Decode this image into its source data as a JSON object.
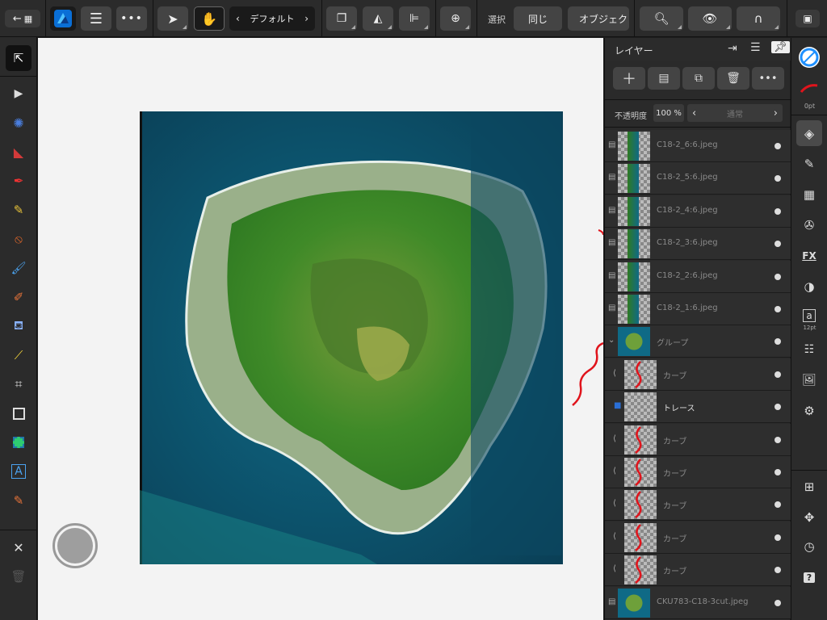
{
  "toolbar": {
    "context_preset_label": "デフォルト",
    "select_label": "選択",
    "same_label": "同じ",
    "object_label": "オブジェク"
  },
  "layers_panel": {
    "title": "レイヤー",
    "opacity_label": "不透明度",
    "opacity_value": "100 %",
    "blend_mode": "通常",
    "layers": [
      {
        "name": "C18-2_6:6.jpeg",
        "type": "image"
      },
      {
        "name": "C18-2_5:6.jpeg",
        "type": "image"
      },
      {
        "name": "C18-2_4:6.jpeg",
        "type": "image"
      },
      {
        "name": "C18-2_3:6.jpeg",
        "type": "image"
      },
      {
        "name": "C18-2_2:6.jpeg",
        "type": "image"
      },
      {
        "name": "C18-2_1:6.jpeg",
        "type": "image"
      },
      {
        "name": "グループ",
        "type": "group"
      },
      {
        "name": "カーブ",
        "type": "curve"
      },
      {
        "name": "トレース",
        "type": "pixel"
      },
      {
        "name": "カーブ",
        "type": "curve"
      },
      {
        "name": "カーブ",
        "type": "curve"
      },
      {
        "name": "カーブ",
        "type": "curve"
      },
      {
        "name": "カーブ",
        "type": "curve"
      },
      {
        "name": "カーブ",
        "type": "curve"
      },
      {
        "name": "CKU783-C18-3cut.jpeg",
        "type": "image"
      }
    ]
  },
  "right_bar": {
    "stroke_width": "0pt",
    "text_size": "12pt"
  },
  "colors": {
    "accent": "#1e90ff",
    "curve_red": "#e0141c",
    "sea": "#0e5b75",
    "land": "#3d8a2a"
  }
}
